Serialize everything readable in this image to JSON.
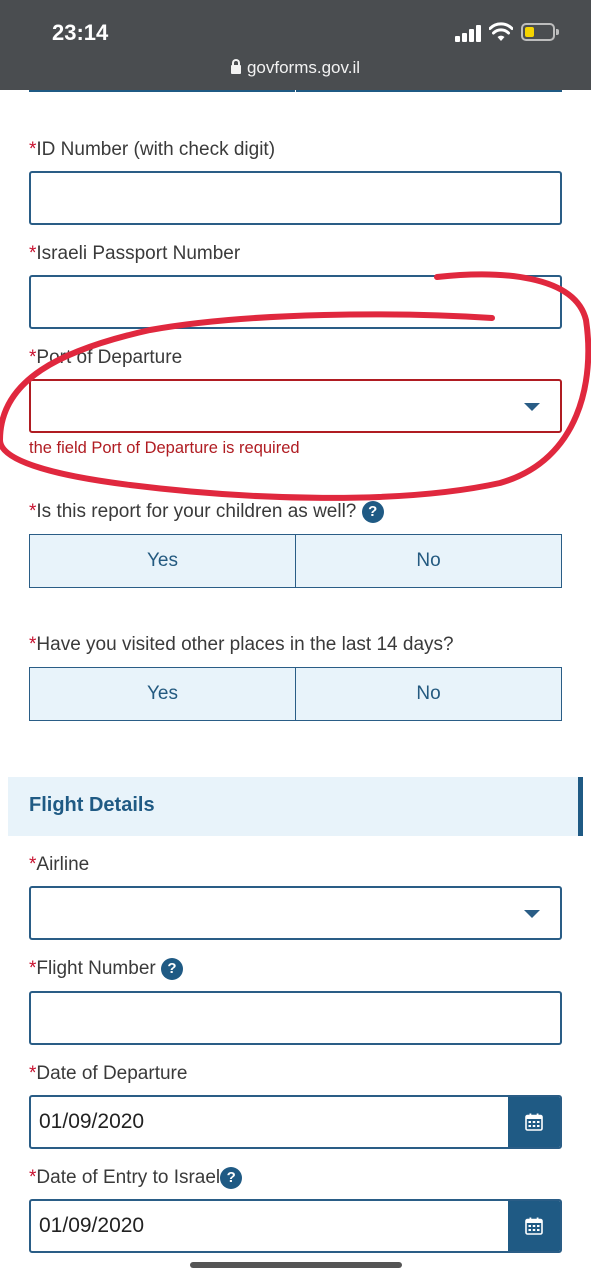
{
  "status_bar": {
    "time": "23:14",
    "url": "govforms.gov.il"
  },
  "form": {
    "required_mark": "*",
    "id_number": {
      "label": "ID Number (with check digit)",
      "value": ""
    },
    "passport": {
      "label": "Israeli Passport Number",
      "value": ""
    },
    "port": {
      "label": "Port of Departure",
      "value": "",
      "error": "the field Port of Departure is required"
    },
    "children": {
      "label": "Is this report for your children as well?",
      "help": "?",
      "options": [
        "Yes",
        "No"
      ]
    },
    "visited": {
      "label": "Have you visited other places in the last 14 days?",
      "options": [
        "Yes",
        "No"
      ]
    }
  },
  "flight": {
    "section_title": "Flight Details",
    "airline": {
      "label": "Airline",
      "value": ""
    },
    "flight_number": {
      "label": "Flight Number",
      "help": "?",
      "value": ""
    },
    "departure_date": {
      "label": "Date of Departure",
      "value": "01/09/2020"
    },
    "entry_date": {
      "label": "Date of Entry to Israel",
      "help": "?",
      "value": "01/09/2020"
    }
  },
  "colors": {
    "accent": "#1f5a84",
    "error": "#b01c22",
    "required": "#c8102e",
    "annotation": "#e0283e",
    "toggle_bg": "#e8f3fa"
  }
}
